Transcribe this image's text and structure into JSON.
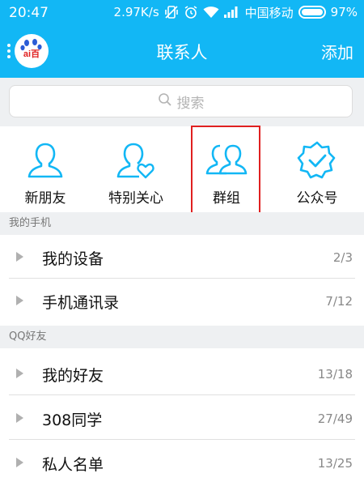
{
  "status_bar": {
    "time": "20:47",
    "speed": "2.97K/s",
    "carrier": "中国移动",
    "battery": "97%"
  },
  "header": {
    "title": "联系人",
    "add_label": "添加",
    "avatar_text": "ai百"
  },
  "search": {
    "placeholder": "搜索"
  },
  "categories": [
    {
      "label": "新朋友",
      "icon": "person-icon"
    },
    {
      "label": "特别关心",
      "icon": "person-heart-icon"
    },
    {
      "label": "群组",
      "icon": "group-icon"
    },
    {
      "label": "公众号",
      "icon": "badge-check-icon"
    }
  ],
  "sections": [
    {
      "title": "我的手机",
      "rows": [
        {
          "label": "我的设备",
          "count": "2/3"
        },
        {
          "label": "手机通讯录",
          "count": "7/12"
        }
      ]
    },
    {
      "title": "QQ好友",
      "rows": [
        {
          "label": "我的好友",
          "count": "13/18"
        },
        {
          "label": "308同学",
          "count": "27/49"
        },
        {
          "label": "私人名单",
          "count": "13/25"
        }
      ]
    }
  ],
  "colors": {
    "header_blue": "#12b7f5",
    "icon_blue": "#12b7f5",
    "highlight_red": "#e02020"
  }
}
